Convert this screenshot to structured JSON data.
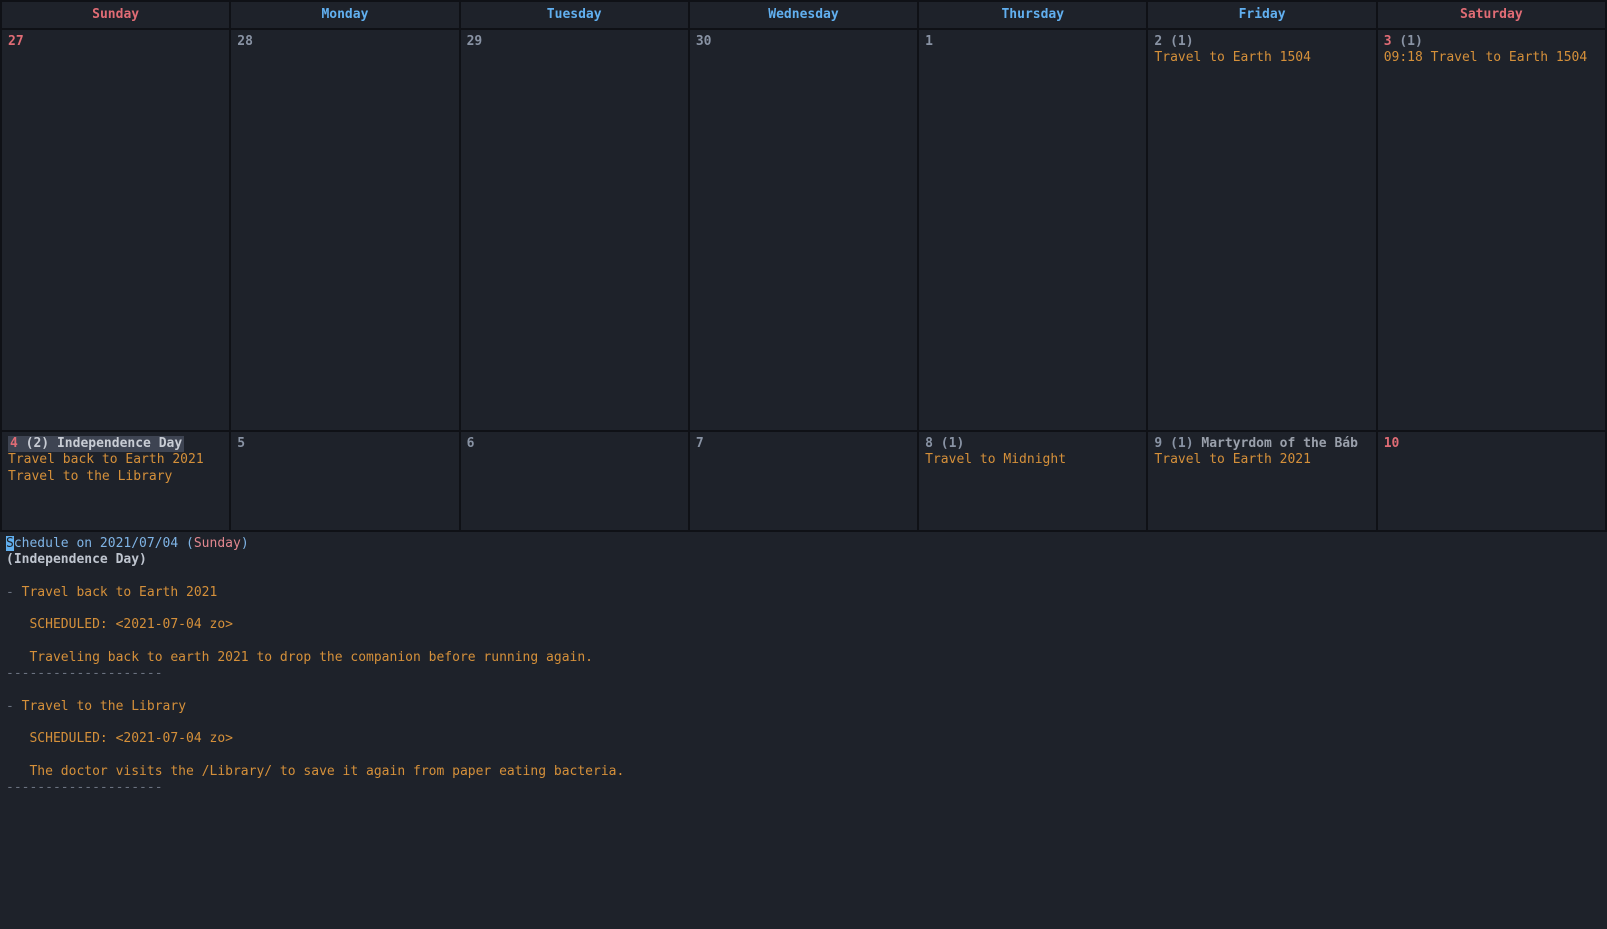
{
  "days": [
    "Sunday",
    "Monday",
    "Tuesday",
    "Wednesday",
    "Thursday",
    "Friday",
    "Saturday"
  ],
  "row1": [
    {
      "num": "27",
      "weekend": true,
      "count": "",
      "holiday": "",
      "events": []
    },
    {
      "num": "28",
      "weekend": false,
      "count": "",
      "holiday": "",
      "events": []
    },
    {
      "num": "29",
      "weekend": false,
      "count": "",
      "holiday": "",
      "events": []
    },
    {
      "num": "30",
      "weekend": false,
      "count": "",
      "holiday": "",
      "events": []
    },
    {
      "num": "1",
      "weekend": false,
      "count": "",
      "holiday": "",
      "events": []
    },
    {
      "num": "2",
      "weekend": false,
      "count": "(1)",
      "holiday": "",
      "events": [
        "Travel to Earth 1504"
      ]
    },
    {
      "num": "3",
      "weekend": true,
      "count": "(1)",
      "holiday": "",
      "events": [
        "09:18 Travel to Earth 1504"
      ]
    }
  ],
  "row2": [
    {
      "num": "4",
      "weekend": true,
      "count": "(2)",
      "holiday": "Independence Day",
      "events": [
        "Travel back to Earth 2021",
        "Travel to the Library"
      ],
      "selected": true
    },
    {
      "num": "5",
      "weekend": false,
      "count": "",
      "holiday": "",
      "events": []
    },
    {
      "num": "6",
      "weekend": false,
      "count": "",
      "holiday": "",
      "events": []
    },
    {
      "num": "7",
      "weekend": false,
      "count": "",
      "holiday": "",
      "events": []
    },
    {
      "num": "8",
      "weekend": false,
      "count": "(1)",
      "holiday": "",
      "events": [
        "Travel to Midnight"
      ]
    },
    {
      "num": "9",
      "weekend": false,
      "count": "(1)",
      "holiday": "Martyrdom of the Báb",
      "events": [
        "Travel to Earth 2021"
      ]
    },
    {
      "num": "10",
      "weekend": true,
      "count": "",
      "holiday": "",
      "events": []
    }
  ],
  "schedule": {
    "title_prefix": "S",
    "title_rest": "chedule on 2021/07/04 (",
    "title_day": "Sunday",
    "title_close": ")",
    "subtitle": "(Independence Day)",
    "items": [
      {
        "title": "Travel back to Earth 2021",
        "sched_line": "   SCHEDULED: <2021-07-04 zo>",
        "body": "   Traveling back to earth 2021 to drop the companion before running again."
      },
      {
        "title": "Travel to the Library",
        "sched_line": "   SCHEDULED: <2021-07-04 zo>",
        "body": "   The doctor visits the /Library/ to save it again from paper eating bacteria."
      }
    ],
    "divider": "--------------------"
  }
}
